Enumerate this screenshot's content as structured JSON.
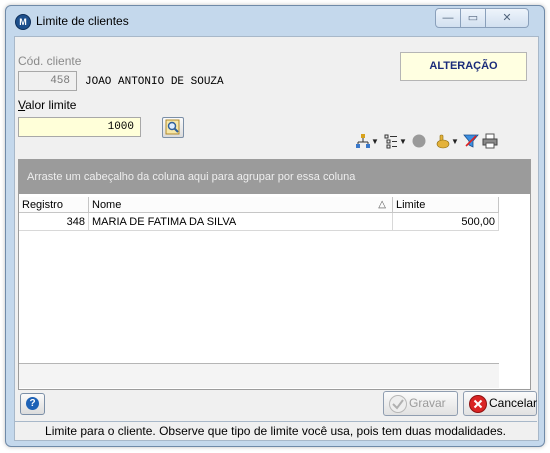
{
  "window": {
    "title": "Limite de clientes",
    "app_icon_glyph": "M",
    "caption": {
      "minimize": "—",
      "maximize": "▭",
      "close": "✕"
    }
  },
  "form": {
    "cod_cliente_label": "Cód. cliente",
    "cod_cliente_value": "458",
    "client_name": "JOAO ANTONIO DE SOUZA",
    "valor_limite_label": "Valor limite",
    "valor_limite_value": "1000",
    "mode_badge": "ALTERAÇÃO"
  },
  "toolbar": {
    "icons": [
      "hierarchy-icon",
      "list-tree-icon",
      "record-circle-icon",
      "hand-icon",
      "filter-icon",
      "print-icon"
    ]
  },
  "grid": {
    "group_panel_text": "Arraste um cabeçalho da coluna aqui para agrupar por essa coluna",
    "columns": [
      "Registro",
      "Nome",
      "Limite"
    ],
    "sort_indicator": "△",
    "rows": [
      {
        "registro": "348",
        "nome": "MARIA DE FATIMA DA SILVA",
        "limite": "500,00"
      }
    ]
  },
  "buttons": {
    "help": "?",
    "gravar": "Gravar",
    "cancelar": "Cancelar"
  },
  "status": "Limite para o cliente. Observe que tipo de limite você usa, pois tem duas modalidades.",
  "colors": {
    "window_frame": "#c4d8ec",
    "mode_badge_bg": "#ffffe1",
    "input_highlight": "#ffffd9",
    "group_panel": "#9b9b9b"
  }
}
